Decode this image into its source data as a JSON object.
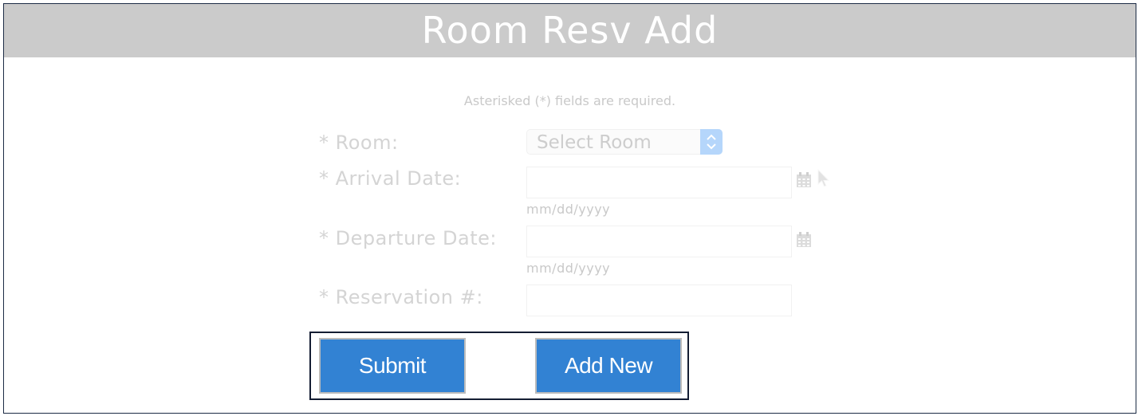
{
  "header": {
    "title": "Room Resv Add"
  },
  "form": {
    "required_note": "Asterisked (*) fields are required.",
    "room": {
      "label": "* Room:",
      "selected": "Select Room"
    },
    "arrival_date": {
      "label": "* Arrival Date:",
      "value": "",
      "format_hint": "mm/dd/yyyy"
    },
    "departure_date": {
      "label": "* Departure Date:",
      "value": "",
      "format_hint": "mm/dd/yyyy"
    },
    "reservation_number": {
      "label": "* Reservation #:",
      "value": ""
    }
  },
  "actions": {
    "submit_label": "Submit",
    "add_new_label": "Add New"
  },
  "icons": {
    "calendar": "calendar-icon",
    "cursor": "mouse-pointer-icon",
    "select_arrows": "chevron-up-down-icon"
  },
  "colors": {
    "header_bg": "#cbcbcb",
    "button_bg": "#3282d3",
    "select_button_bg": "#b5d6fb",
    "highlight_border": "#141d33"
  }
}
